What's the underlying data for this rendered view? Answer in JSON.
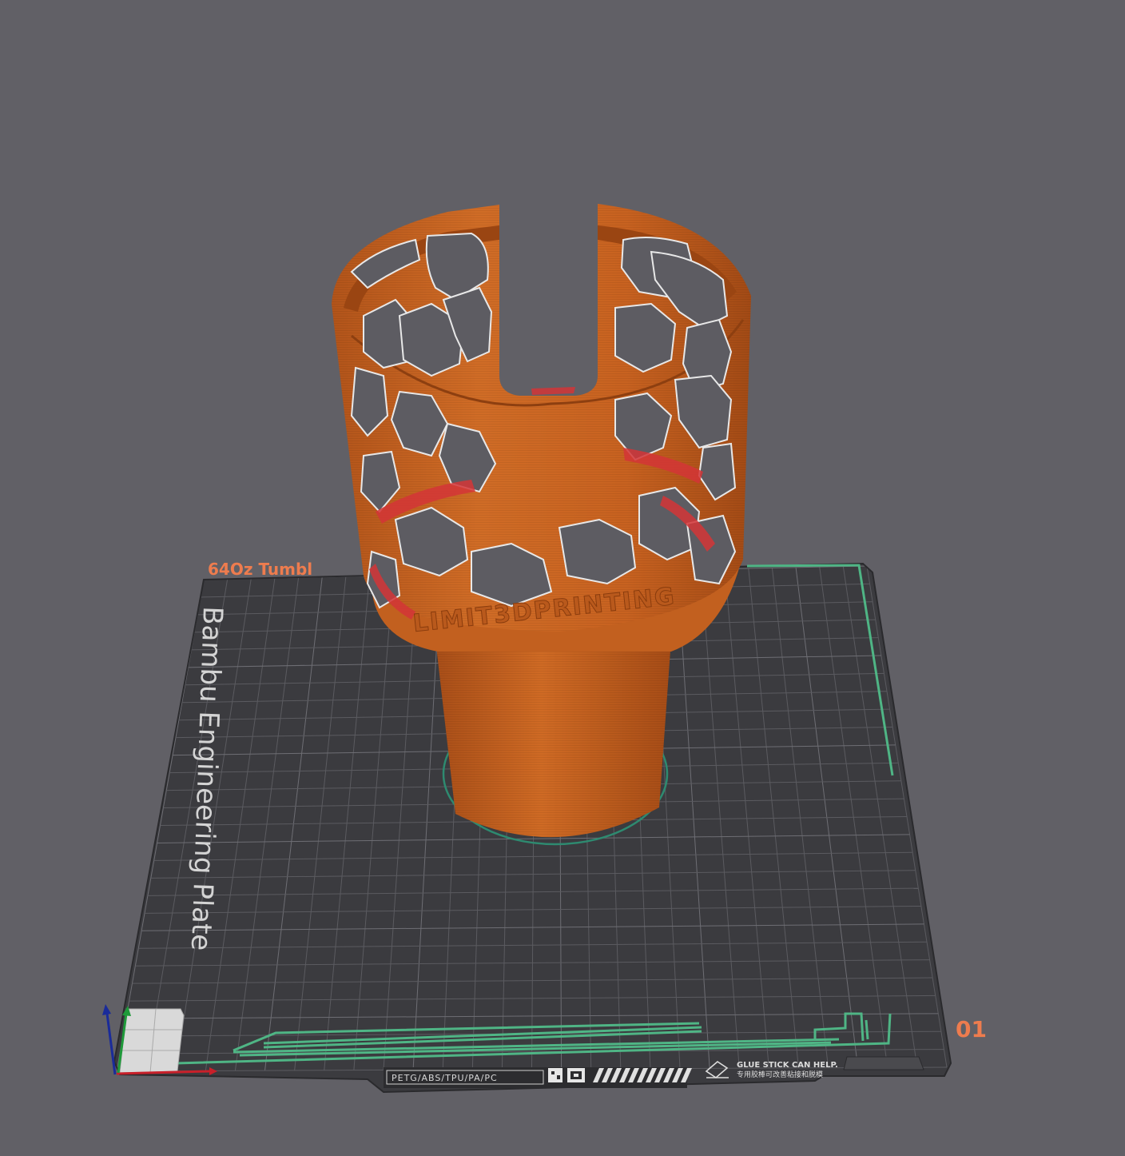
{
  "plate": {
    "name_label": "64Oz Tumbl",
    "index_label": "01",
    "bed_title": "Bambu Engineering Plate",
    "material_compat": "PETG/ABS/TPU/PA/PC",
    "glue_note_en": "GLUE STICK CAN HELP.",
    "glue_note_cn": "专用胶棒可改善粘接和脱模"
  },
  "model": {
    "embossed_text": "LIMIT3DPRINTING"
  },
  "colors": {
    "background": "#616066",
    "bed": "#3b3b3f",
    "grid": "#5f5f64",
    "model": "#c8641f",
    "accent_orange": "#ee7c4e",
    "skirt_green": "#4fb585"
  },
  "icons": {
    "axis_gizmo": "xyz-axis-icon"
  }
}
